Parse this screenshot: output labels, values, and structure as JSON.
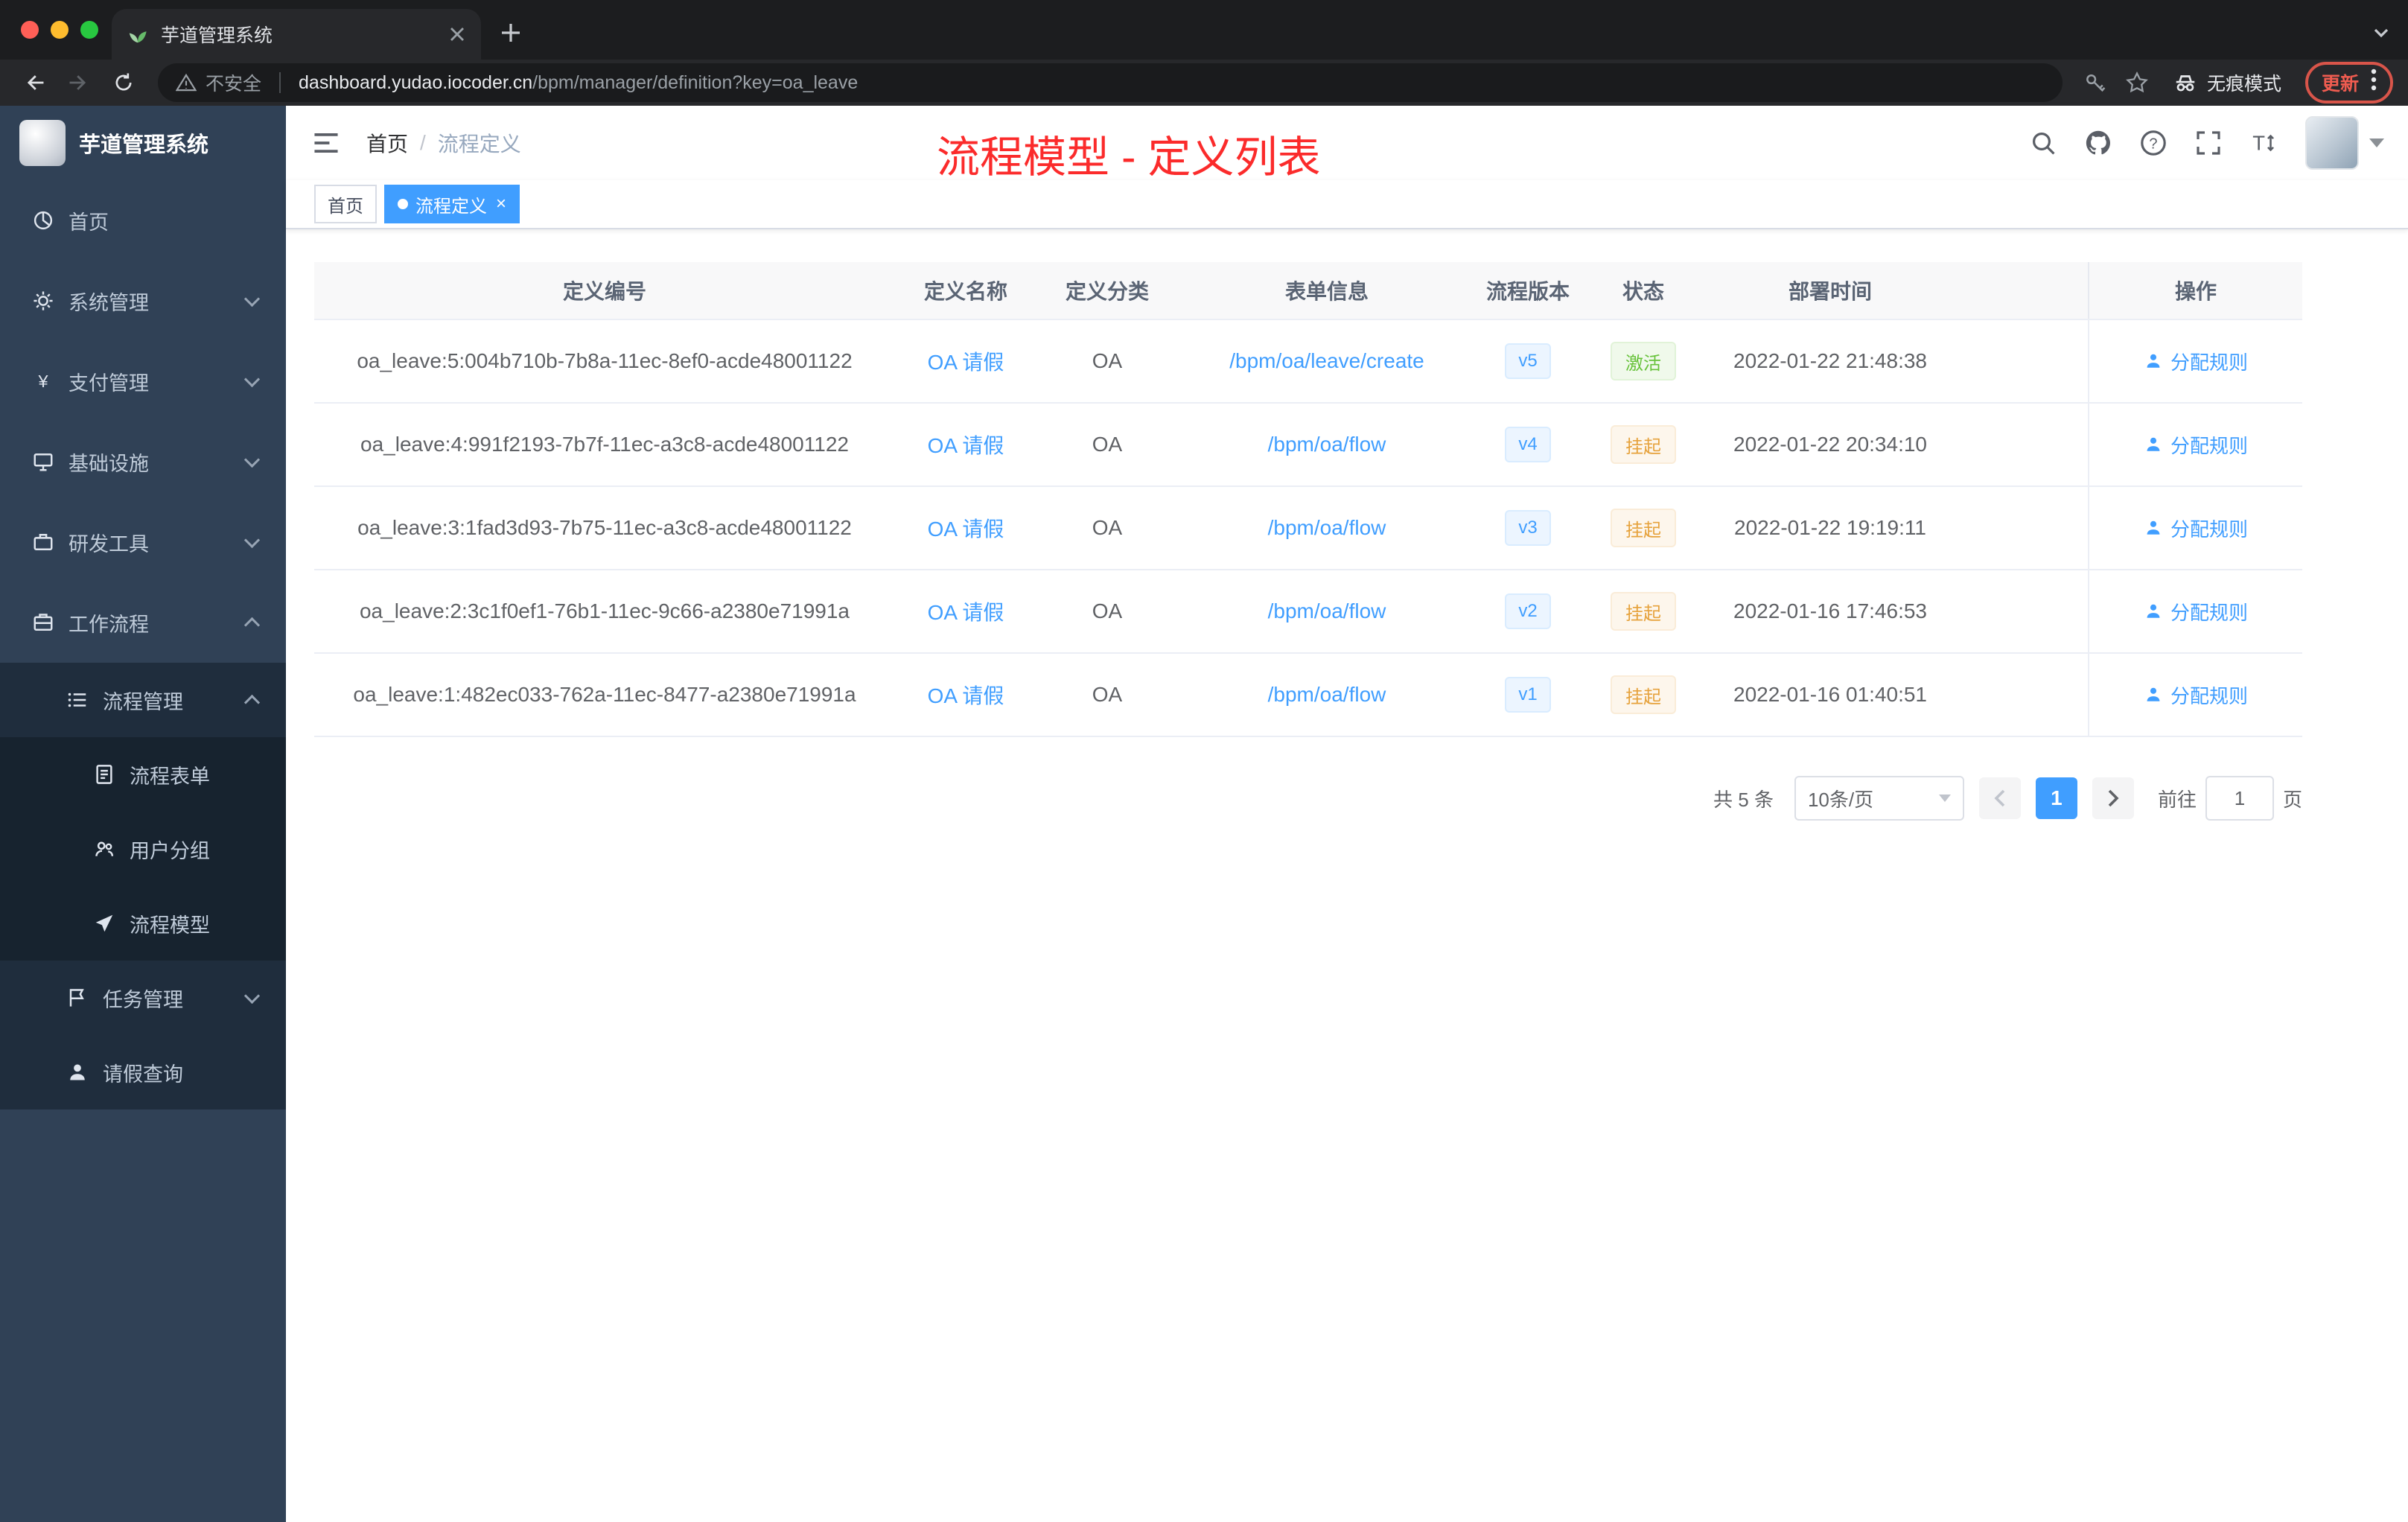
{
  "colors": {
    "primary": "#409eff",
    "success": "#67c23a",
    "warning": "#e6a23c",
    "annotation_red": "#fb2b2b",
    "sidebar_bg": "#304156",
    "sidebar_sub_bg": "#1f2d3d",
    "tag_active_bg": "#409eff",
    "update_pill": "#ef5c50"
  },
  "browser": {
    "tab_title": "芋道管理系统",
    "security_label": "不安全",
    "url_host": "dashboard.yudao.iocoder.cn",
    "url_path": "/bpm/manager/definition?key=oa_leave",
    "incognito_label": "无痕模式",
    "update_label": "更新"
  },
  "sidebar": {
    "title": "芋道管理系统",
    "items": [
      {
        "label": "首页",
        "icon": "dashboard-icon",
        "level": 1
      },
      {
        "label": "系统管理",
        "icon": "gear-icon",
        "level": 1,
        "chevron": "down"
      },
      {
        "label": "支付管理",
        "icon": "yen-icon",
        "level": 1,
        "chevron": "down"
      },
      {
        "label": "基础设施",
        "icon": "infrastructure-icon",
        "level": 1,
        "chevron": "down"
      },
      {
        "label": "研发工具",
        "icon": "tools-icon",
        "level": 1,
        "chevron": "down"
      },
      {
        "label": "工作流程",
        "icon": "workflow-icon",
        "level": 1,
        "chevron": "up"
      },
      {
        "label": "流程管理",
        "icon": "process-manage-icon",
        "level": 2,
        "chevron": "up"
      },
      {
        "label": "流程表单",
        "icon": "form-icon",
        "level": 3
      },
      {
        "label": "用户分组",
        "icon": "user-group-icon",
        "level": 3
      },
      {
        "label": "流程模型",
        "icon": "process-model-icon",
        "level": 3
      },
      {
        "label": "任务管理",
        "icon": "task-icon",
        "level": 2,
        "chevron": "down"
      },
      {
        "label": "请假查询",
        "icon": "leave-icon",
        "level": 2
      }
    ]
  },
  "header": {
    "breadcrumb": [
      "首页",
      "流程定义"
    ],
    "separator": "/",
    "annotation": "流程模型 - 定义列表"
  },
  "tags": [
    {
      "label": "首页",
      "active": false
    },
    {
      "label": "流程定义",
      "active": true
    }
  ],
  "table": {
    "columns": [
      "定义编号",
      "定义名称",
      "定义分类",
      "表单信息",
      "流程版本",
      "状态",
      "部署时间",
      "操作"
    ],
    "action_label": "分配规则",
    "rows": [
      {
        "id": "oa_leave:5:004b710b-7b8a-11ec-8ef0-acde48001122",
        "name": "OA 请假",
        "category": "OA",
        "form": "/bpm/oa/leave/create",
        "version": "v5",
        "status": "激活",
        "status_type": "success",
        "time": "2022-01-22 21:48:38"
      },
      {
        "id": "oa_leave:4:991f2193-7b7f-11ec-a3c8-acde48001122",
        "name": "OA 请假",
        "category": "OA",
        "form": "/bpm/oa/flow",
        "version": "v4",
        "status": "挂起",
        "status_type": "warning",
        "time": "2022-01-22 20:34:10"
      },
      {
        "id": "oa_leave:3:1fad3d93-7b75-11ec-a3c8-acde48001122",
        "name": "OA 请假",
        "category": "OA",
        "form": "/bpm/oa/flow",
        "version": "v3",
        "status": "挂起",
        "status_type": "warning",
        "time": "2022-01-22 19:19:11"
      },
      {
        "id": "oa_leave:2:3c1f0ef1-76b1-11ec-9c66-a2380e71991a",
        "name": "OA 请假",
        "category": "OA",
        "form": "/bpm/oa/flow",
        "version": "v2",
        "status": "挂起",
        "status_type": "warning",
        "time": "2022-01-16 17:46:53"
      },
      {
        "id": "oa_leave:1:482ec033-762a-11ec-8477-a2380e71991a",
        "name": "OA 请假",
        "category": "OA",
        "form": "/bpm/oa/flow",
        "version": "v1",
        "status": "挂起",
        "status_type": "warning",
        "time": "2022-01-16 01:40:51"
      }
    ]
  },
  "pagination": {
    "total": "共 5 条",
    "page_size": "10条/页",
    "current_page": "1",
    "goto_label": "前往",
    "goto_value": "1",
    "goto_unit": "页"
  }
}
